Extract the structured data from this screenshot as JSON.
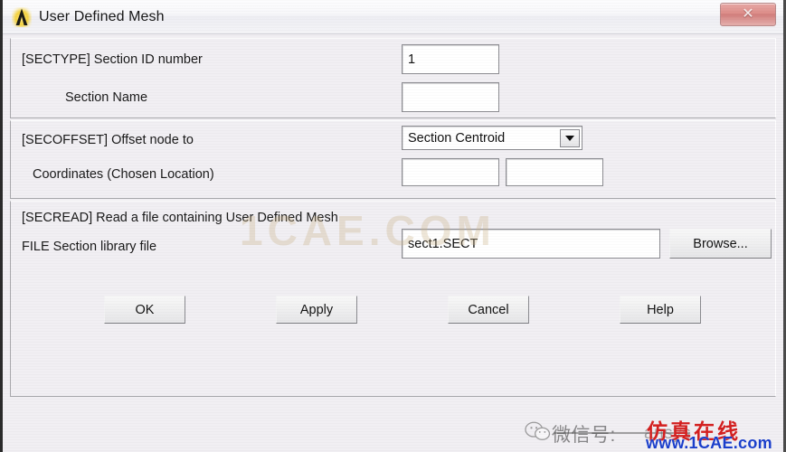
{
  "window": {
    "title": "User Defined Mesh",
    "icon": "ansys-logo-icon",
    "close_label": "✕"
  },
  "sections": {
    "sectype": {
      "id_label": "[SECTYPE] Section ID number",
      "id_value": "1",
      "name_label": "Section Name",
      "name_value": "",
      "name_placeholder": ""
    },
    "secoffset": {
      "offset_label": "[SECOFFSET] Offset node to",
      "offset_value": "Section Centroid",
      "offset_options": [
        "Section Centroid"
      ],
      "coords_label": "Coordinates (Chosen Location)",
      "coord_x_value": "",
      "coord_y_value": ""
    },
    "secread": {
      "title_label": "[SECREAD]  Read a file containing User Defined Mesh",
      "file_label": "FILE    Section library file",
      "file_value": "sect1.SECT",
      "browse_label": "Browse..."
    }
  },
  "buttons": {
    "ok": "OK",
    "apply": "Apply",
    "cancel": "Cancel",
    "help": "Help"
  },
  "watermarks": {
    "center": "1CAE.COM",
    "wechat_label": "微信号:",
    "wechat_id": "ansys",
    "red_text": "仿真在线",
    "blue_text": "www.1CAE.com"
  },
  "colors": {
    "dialog_bg": "#f1eff3",
    "close_button": "#dd8d89",
    "watermark_red": "#d42020",
    "watermark_blue": "#1b3fcc",
    "logo_gold": "#f5d33f"
  }
}
